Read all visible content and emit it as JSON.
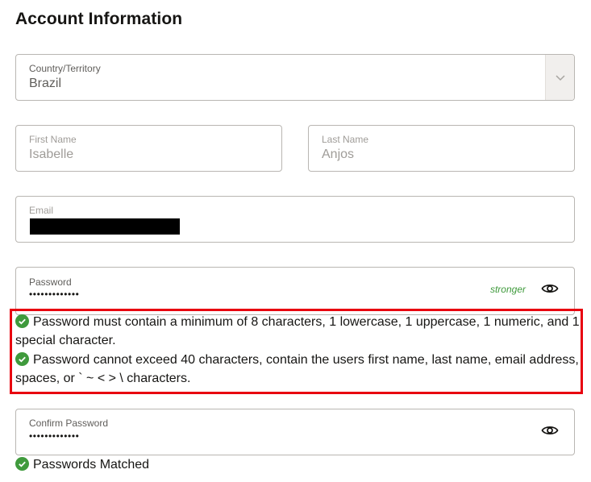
{
  "page": {
    "title": "Account Information"
  },
  "country": {
    "label": "Country/Territory",
    "value": "Brazil",
    "icon": "chevron-down-icon"
  },
  "first_name": {
    "label": "First Name",
    "value": "Isabelle"
  },
  "last_name": {
    "label": "Last Name",
    "value": "Anjos"
  },
  "email": {
    "label": "Email",
    "value": ""
  },
  "password": {
    "label": "Password",
    "value": "•••••••••••••",
    "strength": "stronger",
    "icon": "eye-icon"
  },
  "rules": {
    "rule1": "Password must contain a minimum of 8 characters, 1 lowercase, 1 uppercase, 1 numeric, and 1 special character.",
    "rule2": "Password cannot exceed 40 characters, contain the users first name, last name, email address, spaces, or ` ~ < > \\ characters."
  },
  "confirm_password": {
    "label": "Confirm Password",
    "value": "•••••••••••••",
    "icon": "eye-icon"
  },
  "match_status": {
    "text": "Passwords Matched"
  },
  "colors": {
    "success": "#3f9a3c",
    "highlight": "#e8000f",
    "border": "#b9b6b2"
  }
}
